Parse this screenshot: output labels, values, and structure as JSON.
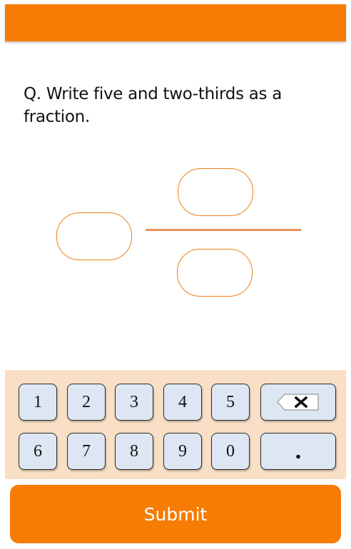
{
  "question": {
    "text": "Q. Write five and two-thirds as a fraction."
  },
  "answer": {
    "whole": "",
    "numerator": "",
    "denominator": ""
  },
  "keypad": {
    "row1": [
      "1",
      "2",
      "3",
      "4",
      "5"
    ],
    "row2": [
      "6",
      "7",
      "8",
      "9",
      "0"
    ],
    "backspace_icon": "backspace-icon",
    "decimal_label": "."
  },
  "submit": {
    "label": "Submit"
  },
  "colors": {
    "accent": "#f67c03",
    "keypad_bg": "#f9dfc5",
    "key_bg": "#dde6f3",
    "box_border": "#f0801a"
  }
}
